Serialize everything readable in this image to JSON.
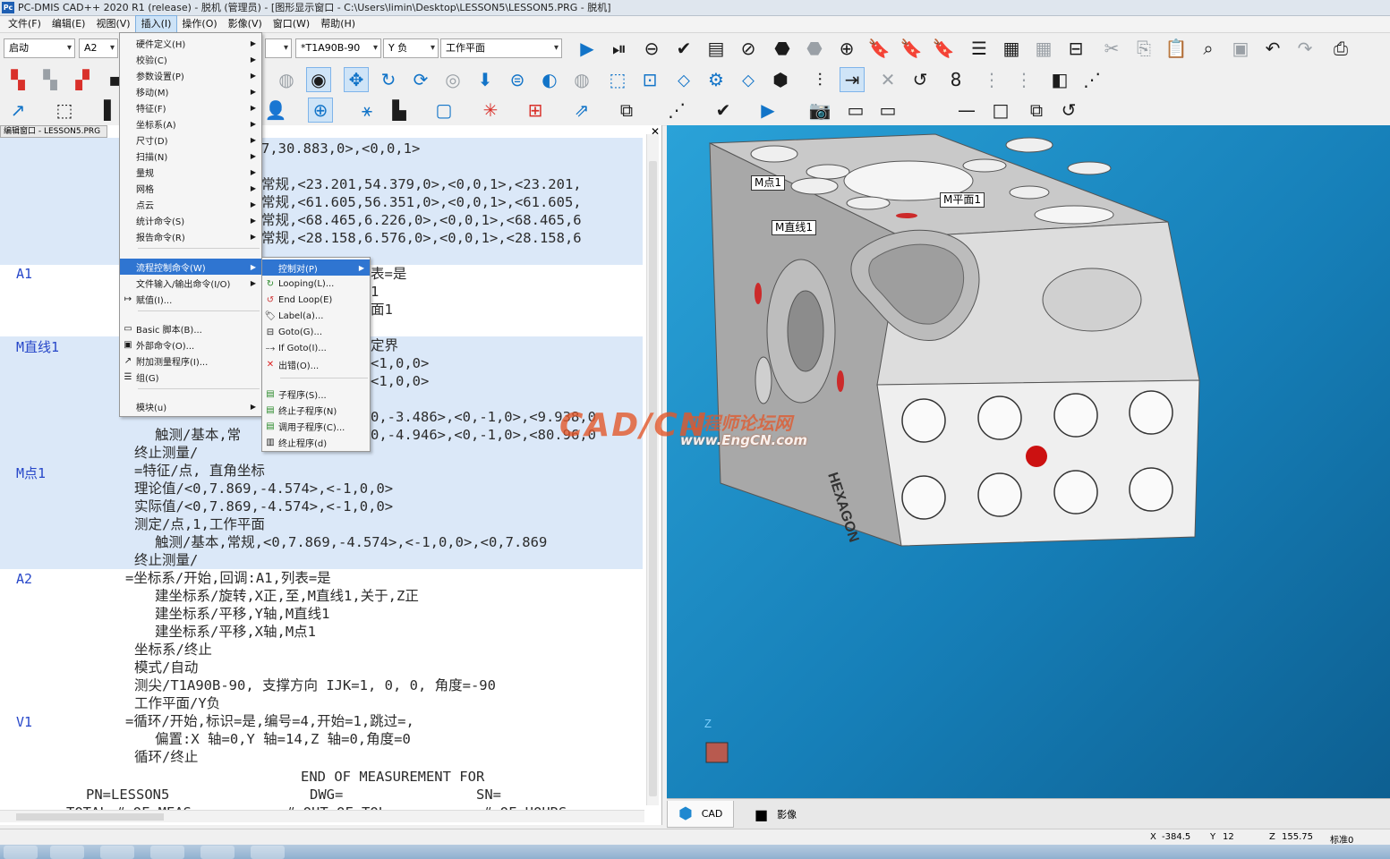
{
  "window": {
    "title": "PC-DMIS CAD++ 2020 R1 (release) - 脱机 (管理员) - [图形显示窗口 - C:\\Users\\limin\\Desktop\\LESSON5\\LESSON5.PRG - 脱机]",
    "app_icon": "Pc"
  },
  "menubar": [
    "文件(F)",
    "编辑(E)",
    "视图(V)",
    "插入(I)",
    "操作(O)",
    "影像(V)",
    "窗口(W)",
    "帮助(H)"
  ],
  "toolbar": {
    "mode_combo": "启动",
    "alignment_combo": "A2",
    "probe_combo": "*T1A90B-90",
    "view_combo": "Y 负",
    "workplane_combo": "工作平面"
  },
  "editor": {
    "tab_title": "编辑窗口 - LESSON5.PRG",
    "labels": {
      "a1": "A1",
      "line1": "M直线1",
      "point1": "M点1",
      "a2": "A2",
      "v1": "V1"
    },
    "lines": [
      "7,30.883,0>,<0,0,1>",
      "",
      "常规,<23.201,54.379,0>,<0,0,1>,<23.201,",
      "常规,<61.605,56.351,0>,<0,0,1>,<61.605,",
      "常规,<68.465,6.226,0>,<0,0,1>,<68.465,6",
      "常规,<28.158,6.576,0>,<0,0,1>,<28.158,6",
      "",
      "表=是",
      "1",
      "面1",
      "",
      "定界",
      "<1,0,0>",
      "<1,0,0>",
      "",
      "0,-3.486>,<0,-1,0>,<9.938,0",
      "触测/基本,常",
      "0,-4.946>,<0,-1,0>,<80.96,0",
      "终止测量/",
      "=特征/点, 直角坐标",
      "理论值/<0,7.869,-4.574>,<-1,0,0>",
      "实际值/<0,7.869,-4.574>,<-1,0,0>",
      "测定/点,1,工作平面",
      "触测/基本,常规,<0,7.869,-4.574>,<-1,0,0>,<0,7.869",
      "终止测量/",
      "=坐标系/开始,回调:A1,列表=是",
      "建坐标系/旋转,X正,至,M直线1,关于,Z正",
      "建坐标系/平移,Y轴,M直线1",
      "建坐标系/平移,X轴,M点1",
      "坐标系/终止",
      "模式/自动",
      "测尖/T1A90B-90, 支撑方向 IJK=1, 0, 0, 角度=-90",
      "工作平面/Y负",
      "=循环/开始,标识=是,编号=4,开始=1,跳过=,",
      "偏置:X 轴=0,Y 轴=14,Z 轴=0,角度=0",
      "循环/终止",
      "END OF MEASUREMENT FOR",
      "PN=LESSON5",
      "DWG=",
      "SN=",
      "TOTAL # OF MEAS",
      "# OUT OF TOL",
      "# OF HOURS"
    ]
  },
  "insert_menu": {
    "items": [
      {
        "label": "硬件定义(H)",
        "sub": true
      },
      {
        "label": "校验(C)",
        "sub": true
      },
      {
        "label": "参数设置(P)",
        "sub": true
      },
      {
        "label": "移动(M)",
        "sub": true
      },
      {
        "label": "特征(F)",
        "sub": true
      },
      {
        "label": "坐标系(A)",
        "sub": true
      },
      {
        "label": "尺寸(D)",
        "sub": true
      },
      {
        "label": "扫描(N)",
        "sub": true
      },
      {
        "label": "量规",
        "sub": true
      },
      {
        "label": "网格",
        "sub": true
      },
      {
        "label": "点云",
        "sub": true
      },
      {
        "label": "统计命令(S)",
        "sub": true
      },
      {
        "label": "报告命令(R)",
        "sub": true
      },
      {
        "label": "流程控制命令(W)",
        "sub": true,
        "selected": true
      },
      {
        "label": "文件输入/输出命令(I/O)",
        "sub": true
      },
      {
        "label": "赋值(I)..."
      },
      {
        "label": "Basic 脚本(B)..."
      },
      {
        "label": "外部命令(O)..."
      },
      {
        "label": "附加测量程序(I)..."
      },
      {
        "label": "组(G)"
      },
      {
        "label": "模块(u)",
        "sub": true
      }
    ]
  },
  "flow_submenu": {
    "items": [
      {
        "label": "控制对(P)",
        "sub": true,
        "selected": true
      },
      {
        "label": "Looping(L)..."
      },
      {
        "label": "End Loop(E)"
      },
      {
        "label": "Label(a)..."
      },
      {
        "label": "Goto(G)..."
      },
      {
        "label": "If Goto(I)..."
      },
      {
        "label": "出错(O)..."
      },
      {
        "label": "子程序(S)..."
      },
      {
        "label": "终止子程序(N)"
      },
      {
        "label": "调用子程序(C)..."
      },
      {
        "label": "终止程序(d)"
      }
    ]
  },
  "graphics": {
    "labels": {
      "point": "M点1",
      "line": "M直线1",
      "plane": "M平面1"
    },
    "axis_z": "Z",
    "brand": "HEXAGON"
  },
  "graphics_tabs": {
    "cad": "CAD",
    "vision": "影像"
  },
  "status": {
    "x_label": "X",
    "x": "-384.5",
    "y_label": "Y",
    "y": "12",
    "z_label": "Z",
    "z": "155.75",
    "mode": "标准0"
  },
  "watermark": {
    "logo": "CAD/CN",
    "cn": "工程师论坛网",
    "url": "www.EngCN.com"
  },
  "colors": {
    "viewport_top": "#2aa2d8",
    "viewport_bottom": "#0d5f91",
    "menu_highlight": "#2f75d1",
    "code_label": "#2747c9",
    "highlight_row": "#dbe8f8"
  }
}
